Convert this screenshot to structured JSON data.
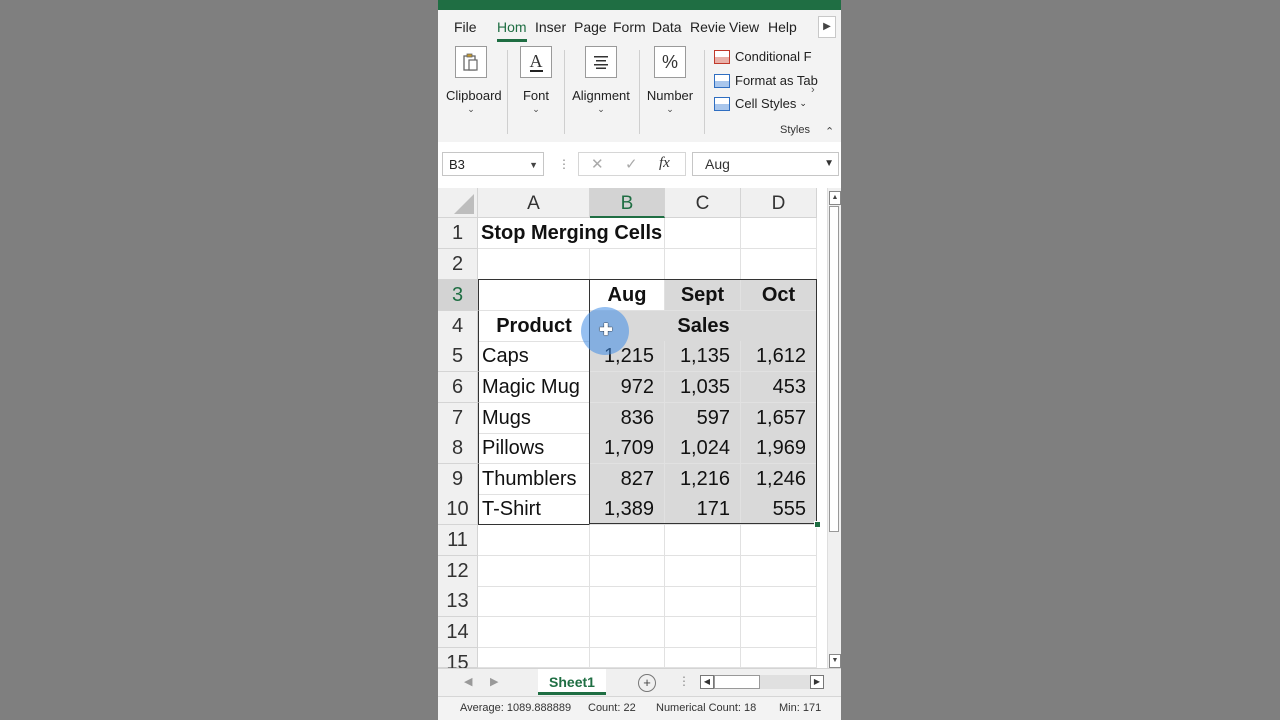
{
  "ribbon_tabs": [
    "File",
    "Hom",
    "Inser",
    "Page",
    "Form",
    "Data",
    "Revie",
    "View",
    "Help"
  ],
  "ribbon_groups": {
    "clipboard": "Clipboard",
    "font": "Font",
    "alignment": "Alignment",
    "number": "Number",
    "styles": "Styles",
    "conditional": "Conditional F",
    "format_table": "Format as Tab",
    "cell_styles": "Cell Styles"
  },
  "icon_glyphs": {
    "font": "A",
    "number": "%"
  },
  "formula_bar": {
    "name_box": "B3",
    "value": "Aug",
    "fx": "fx"
  },
  "columns": [
    "A",
    "B",
    "C",
    "D"
  ],
  "rows": [
    "1",
    "2",
    "3",
    "4",
    "5",
    "6",
    "7",
    "8",
    "9",
    "10",
    "11",
    "12",
    "13",
    "14",
    "15"
  ],
  "sheet": {
    "title": "Stop Merging Cells",
    "months": [
      "Aug",
      "Sept",
      "Oct"
    ],
    "product_header": "Product",
    "sales_header": "Sales",
    "products": [
      {
        "name": "Caps",
        "aug": "1,215",
        "sept": "1,135",
        "oct": "1,612"
      },
      {
        "name": "Magic Mug",
        "aug": "972",
        "sept": "1,035",
        "oct": "453"
      },
      {
        "name": "Mugs",
        "aug": "836",
        "sept": "597",
        "oct": "1,657"
      },
      {
        "name": "Pillows",
        "aug": "1,709",
        "sept": "1,024",
        "oct": "1,969"
      },
      {
        "name": "Thumblers",
        "aug": "827",
        "sept": "1,216",
        "oct": "1,246"
      },
      {
        "name": "T-Shirt",
        "aug": "1,389",
        "sept": "171",
        "oct": "555"
      }
    ]
  },
  "sheet_tab": "Sheet1",
  "status": {
    "average": "Average: 1089.888889",
    "count": "Count: 22",
    "numerical_count": "Numerical Count: 18",
    "min": "Min: 171"
  },
  "colors": {
    "accent": "#1f6e43",
    "selection": "#d9d9d9",
    "cursor": "#408ce6"
  }
}
